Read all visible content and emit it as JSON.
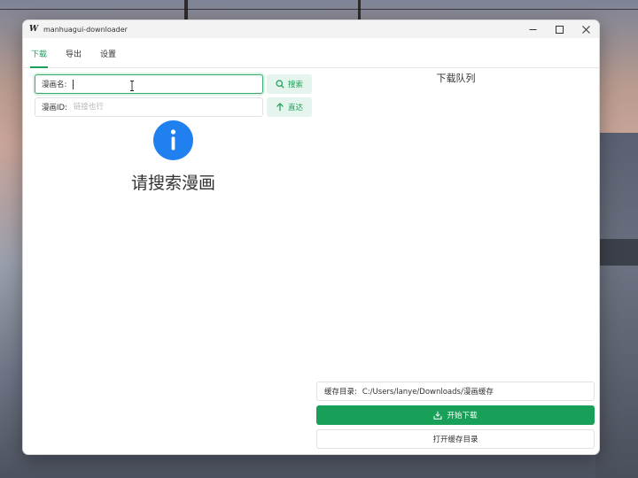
{
  "window": {
    "title": "manhuagui-downloader",
    "app_icon_glyph": "W"
  },
  "tabs": [
    {
      "label": "下载",
      "active": true
    },
    {
      "label": "导出",
      "active": false
    },
    {
      "label": "设置",
      "active": false
    }
  ],
  "search": {
    "name_label": "漫画名:",
    "name_value": "",
    "search_button": "搜索",
    "id_label": "漫画ID:",
    "id_placeholder": "链接也行",
    "direct_button": "直达"
  },
  "empty_state": {
    "icon": "info-icon",
    "text": "请搜索漫画"
  },
  "queue": {
    "title": "下载队列"
  },
  "cache": {
    "label": "缓存目录:",
    "path": "C:/Users/lanye/Downloads/漫画缓存"
  },
  "actions": {
    "start_download": "开始下载",
    "open_cache": "打开缓存目录"
  },
  "colors": {
    "accent": "#18a058",
    "accent_light": "#e5f4ec",
    "info": "#2080f0"
  }
}
